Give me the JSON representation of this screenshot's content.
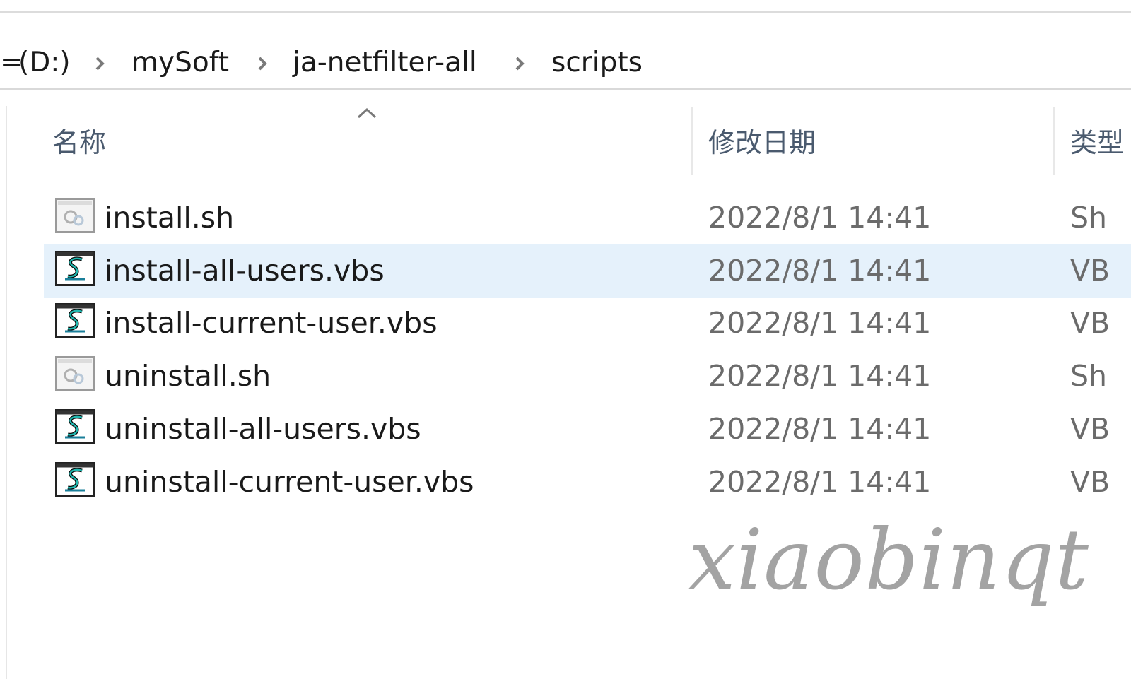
{
  "breadcrumb": {
    "items": [
      {
        "label": "(D:)"
      },
      {
        "label": "mySoft"
      },
      {
        "label": "ja-netfilter-all"
      },
      {
        "label": "scripts"
      }
    ],
    "leading_fragment": "="
  },
  "columns": {
    "name": "名称",
    "date": "修改日期",
    "type": "类型"
  },
  "files": [
    {
      "name": "install.sh",
      "date": "2022/8/1 14:41",
      "type": "Sh",
      "icon": "shell-script-icon",
      "selected": false
    },
    {
      "name": "install-all-users.vbs",
      "date": "2022/8/1 14:41",
      "type": "VB",
      "icon": "vbscript-icon",
      "selected": true
    },
    {
      "name": "install-current-user.vbs",
      "date": "2022/8/1 14:41",
      "type": "VB",
      "icon": "vbscript-icon",
      "selected": false
    },
    {
      "name": "uninstall.sh",
      "date": "2022/8/1 14:41",
      "type": "Sh",
      "icon": "shell-script-icon",
      "selected": false
    },
    {
      "name": "uninstall-all-users.vbs",
      "date": "2022/8/1 14:41",
      "type": "VB",
      "icon": "vbscript-icon",
      "selected": false
    },
    {
      "name": "uninstall-current-user.vbs",
      "date": "2022/8/1 14:41",
      "type": "VB",
      "icon": "vbscript-icon",
      "selected": false
    }
  ],
  "watermark": "xiaobinqt",
  "colors": {
    "selection": "#e5f1fb",
    "header_text": "#4a5a6e",
    "date_text": "#6b6b6b"
  }
}
